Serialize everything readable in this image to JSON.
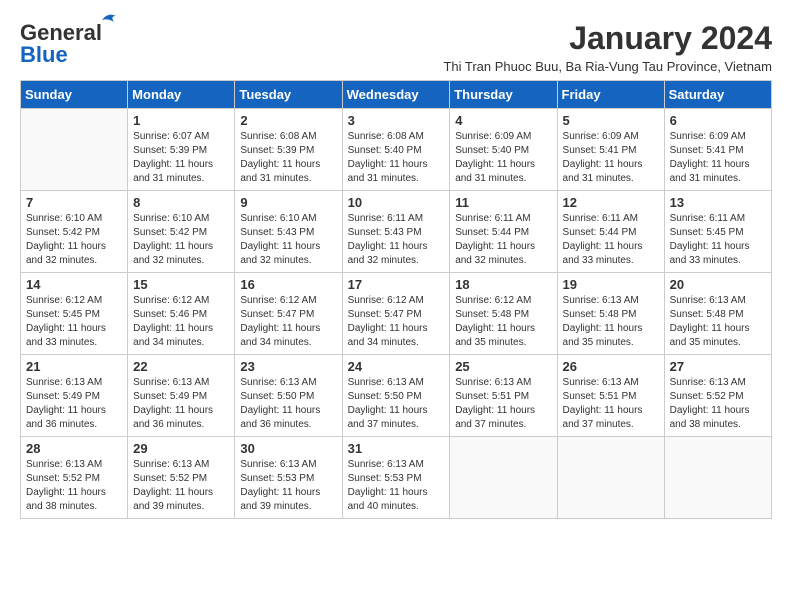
{
  "header": {
    "logo_line1": "General",
    "logo_line2": "Blue",
    "title": "January 2024",
    "subtitle": "Thi Tran Phuoc Buu, Ba Ria-Vung Tau Province, Vietnam"
  },
  "weekdays": [
    "Sunday",
    "Monday",
    "Tuesday",
    "Wednesday",
    "Thursday",
    "Friday",
    "Saturday"
  ],
  "weeks": [
    [
      {
        "day": "",
        "info": ""
      },
      {
        "day": "1",
        "info": "Sunrise: 6:07 AM\nSunset: 5:39 PM\nDaylight: 11 hours\nand 31 minutes."
      },
      {
        "day": "2",
        "info": "Sunrise: 6:08 AM\nSunset: 5:39 PM\nDaylight: 11 hours\nand 31 minutes."
      },
      {
        "day": "3",
        "info": "Sunrise: 6:08 AM\nSunset: 5:40 PM\nDaylight: 11 hours\nand 31 minutes."
      },
      {
        "day": "4",
        "info": "Sunrise: 6:09 AM\nSunset: 5:40 PM\nDaylight: 11 hours\nand 31 minutes."
      },
      {
        "day": "5",
        "info": "Sunrise: 6:09 AM\nSunset: 5:41 PM\nDaylight: 11 hours\nand 31 minutes."
      },
      {
        "day": "6",
        "info": "Sunrise: 6:09 AM\nSunset: 5:41 PM\nDaylight: 11 hours\nand 31 minutes."
      }
    ],
    [
      {
        "day": "7",
        "info": "Sunrise: 6:10 AM\nSunset: 5:42 PM\nDaylight: 11 hours\nand 32 minutes."
      },
      {
        "day": "8",
        "info": "Sunrise: 6:10 AM\nSunset: 5:42 PM\nDaylight: 11 hours\nand 32 minutes."
      },
      {
        "day": "9",
        "info": "Sunrise: 6:10 AM\nSunset: 5:43 PM\nDaylight: 11 hours\nand 32 minutes."
      },
      {
        "day": "10",
        "info": "Sunrise: 6:11 AM\nSunset: 5:43 PM\nDaylight: 11 hours\nand 32 minutes."
      },
      {
        "day": "11",
        "info": "Sunrise: 6:11 AM\nSunset: 5:44 PM\nDaylight: 11 hours\nand 32 minutes."
      },
      {
        "day": "12",
        "info": "Sunrise: 6:11 AM\nSunset: 5:44 PM\nDaylight: 11 hours\nand 33 minutes."
      },
      {
        "day": "13",
        "info": "Sunrise: 6:11 AM\nSunset: 5:45 PM\nDaylight: 11 hours\nand 33 minutes."
      }
    ],
    [
      {
        "day": "14",
        "info": "Sunrise: 6:12 AM\nSunset: 5:45 PM\nDaylight: 11 hours\nand 33 minutes."
      },
      {
        "day": "15",
        "info": "Sunrise: 6:12 AM\nSunset: 5:46 PM\nDaylight: 11 hours\nand 34 minutes."
      },
      {
        "day": "16",
        "info": "Sunrise: 6:12 AM\nSunset: 5:47 PM\nDaylight: 11 hours\nand 34 minutes."
      },
      {
        "day": "17",
        "info": "Sunrise: 6:12 AM\nSunset: 5:47 PM\nDaylight: 11 hours\nand 34 minutes."
      },
      {
        "day": "18",
        "info": "Sunrise: 6:12 AM\nSunset: 5:48 PM\nDaylight: 11 hours\nand 35 minutes."
      },
      {
        "day": "19",
        "info": "Sunrise: 6:13 AM\nSunset: 5:48 PM\nDaylight: 11 hours\nand 35 minutes."
      },
      {
        "day": "20",
        "info": "Sunrise: 6:13 AM\nSunset: 5:48 PM\nDaylight: 11 hours\nand 35 minutes."
      }
    ],
    [
      {
        "day": "21",
        "info": "Sunrise: 6:13 AM\nSunset: 5:49 PM\nDaylight: 11 hours\nand 36 minutes."
      },
      {
        "day": "22",
        "info": "Sunrise: 6:13 AM\nSunset: 5:49 PM\nDaylight: 11 hours\nand 36 minutes."
      },
      {
        "day": "23",
        "info": "Sunrise: 6:13 AM\nSunset: 5:50 PM\nDaylight: 11 hours\nand 36 minutes."
      },
      {
        "day": "24",
        "info": "Sunrise: 6:13 AM\nSunset: 5:50 PM\nDaylight: 11 hours\nand 37 minutes."
      },
      {
        "day": "25",
        "info": "Sunrise: 6:13 AM\nSunset: 5:51 PM\nDaylight: 11 hours\nand 37 minutes."
      },
      {
        "day": "26",
        "info": "Sunrise: 6:13 AM\nSunset: 5:51 PM\nDaylight: 11 hours\nand 37 minutes."
      },
      {
        "day": "27",
        "info": "Sunrise: 6:13 AM\nSunset: 5:52 PM\nDaylight: 11 hours\nand 38 minutes."
      }
    ],
    [
      {
        "day": "28",
        "info": "Sunrise: 6:13 AM\nSunset: 5:52 PM\nDaylight: 11 hours\nand 38 minutes."
      },
      {
        "day": "29",
        "info": "Sunrise: 6:13 AM\nSunset: 5:52 PM\nDaylight: 11 hours\nand 39 minutes."
      },
      {
        "day": "30",
        "info": "Sunrise: 6:13 AM\nSunset: 5:53 PM\nDaylight: 11 hours\nand 39 minutes."
      },
      {
        "day": "31",
        "info": "Sunrise: 6:13 AM\nSunset: 5:53 PM\nDaylight: 11 hours\nand 40 minutes."
      },
      {
        "day": "",
        "info": ""
      },
      {
        "day": "",
        "info": ""
      },
      {
        "day": "",
        "info": ""
      }
    ]
  ]
}
